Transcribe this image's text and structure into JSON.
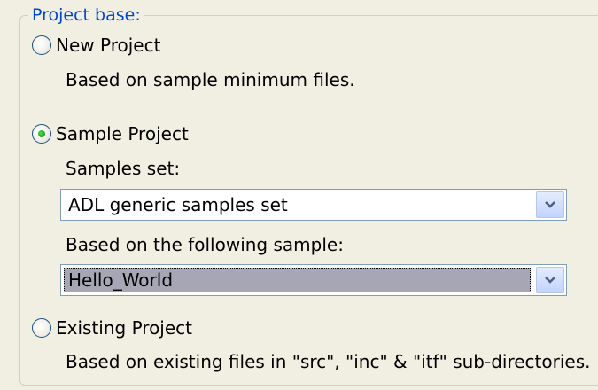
{
  "project_base": {
    "legend": "Project base:",
    "options": {
      "new": {
        "label": "New Project",
        "description": "Based on sample minimum files.",
        "checked": false
      },
      "sample": {
        "label": "Sample Project",
        "checked": true,
        "samples_set_label": "Samples set:",
        "samples_set_value": "ADL generic samples set",
        "sample_label": "Based on the following sample:",
        "sample_value": "Hello_World"
      },
      "existing": {
        "label": "Existing Project",
        "description": "Based on existing files in \"src\", \"inc\" & \"itf\" sub-directories.",
        "checked": false
      }
    }
  },
  "icons": {
    "radio": "radio-button-icon",
    "dropdown": "chevron-down-icon"
  },
  "colors": {
    "legend": "#0046d5",
    "background": "#f1efe2",
    "radio_dot": "#21a121",
    "selection_bg": "#a6a6b4"
  }
}
